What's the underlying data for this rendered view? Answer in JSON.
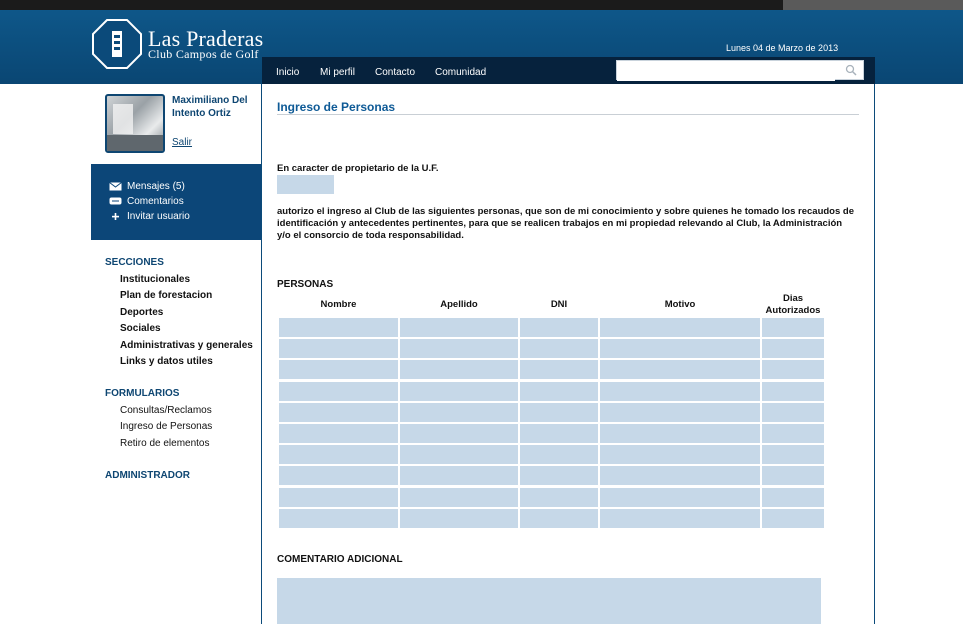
{
  "header": {
    "logo_title": "Las Praderas",
    "logo_subtitle": "Club Campos de Golf",
    "date": "Lunes 04 de Marzo de 2013",
    "nav": [
      "Inicio",
      "Mi perfil",
      "Contacto",
      "Comunidad"
    ],
    "search": {
      "value": "",
      "placeholder": ""
    }
  },
  "sidebar": {
    "user_name": "Maximiliano Del Intento Ortiz",
    "logout_label": "Salir",
    "user_actions": [
      {
        "label": "Mensajes (5)",
        "icon": "envelope-icon"
      },
      {
        "label": "Comentarios",
        "icon": "comment-icon"
      },
      {
        "label": "Invitar usuario",
        "icon": "plus-icon"
      }
    ],
    "sections_title": "SECCIONES",
    "sections": [
      "Institucionales",
      "Plan de forestacion",
      "Deportes",
      "Sociales",
      "Administrativas y generales",
      "Links y datos utiles"
    ],
    "forms_title": "FORMULARIOS",
    "forms": [
      "Consultas/Reclamos",
      "Ingreso de Personas",
      "Retiro de elementos"
    ],
    "admin_title": "ADMINISTRADOR"
  },
  "main": {
    "title": "Ingreso de Personas",
    "owner_label": "En caracter de propietario de la U.F.",
    "uf_value": "",
    "authorization_text": "autorizo el ingreso al Club de las siguientes personas, que son de mi conocimiento y sobre quienes he tomado los recaudos de identificación y antecedentes pertinentes, para que se realicen trabajos en mi propiedad relevando al Club, la Administración y/o el consorcio de toda responsabilidad.",
    "personas_label": "PERSONAS",
    "columns": [
      "Nombre",
      "Apellido",
      "DNI",
      "Motivo",
      "Dias Autorizados"
    ],
    "row_count": 10,
    "comment_label": "COMENTARIO ADICIONAL",
    "comment_value": ""
  },
  "colors": {
    "header_blue": "#0c4f80",
    "nav_dark": "#06223d",
    "field_blue": "#c6d8e8",
    "link_blue": "#0e4672"
  }
}
